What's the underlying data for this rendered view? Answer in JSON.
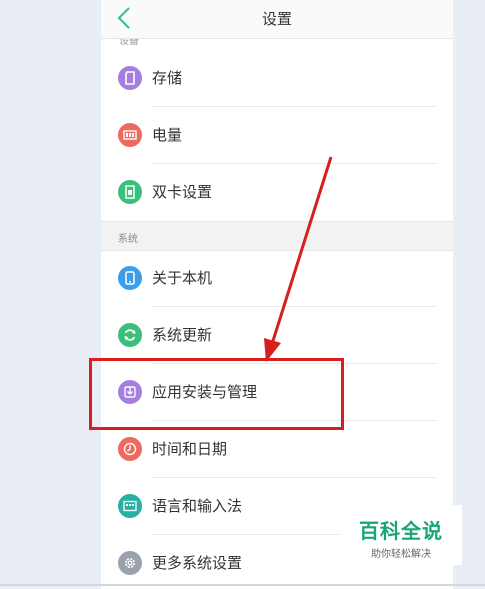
{
  "header": {
    "title": "设置",
    "back_icon": "chevron-left-icon"
  },
  "partial_section_label": "设备",
  "section_label": "系统",
  "items": [
    {
      "label": "存储",
      "icon": "storage-icon",
      "color": "#a67ee0"
    },
    {
      "label": "电量",
      "icon": "battery-icon",
      "color": "#ee6a5e"
    },
    {
      "label": "双卡设置",
      "icon": "dual-sim-icon",
      "color": "#3cbf7a"
    },
    {
      "label": "关于本机",
      "icon": "phone-info-icon",
      "color": "#3d9de8"
    },
    {
      "label": "系统更新",
      "icon": "refresh-icon",
      "color": "#3cbf7a"
    },
    {
      "label": "应用安装与管理",
      "icon": "app-install-icon",
      "color": "#a67ee0"
    },
    {
      "label": "时间和日期",
      "icon": "clock-icon",
      "color": "#ee6a5e"
    },
    {
      "label": "语言和输入法",
      "icon": "keyboard-icon",
      "color": "#27b0a3"
    },
    {
      "label": "更多系统设置",
      "icon": "gear-icon",
      "color": "#9aa3ad"
    }
  ],
  "watermark": {
    "title": "百科全说",
    "subtitle": "助你轻松解决"
  },
  "annotation_color": "#d5201e"
}
